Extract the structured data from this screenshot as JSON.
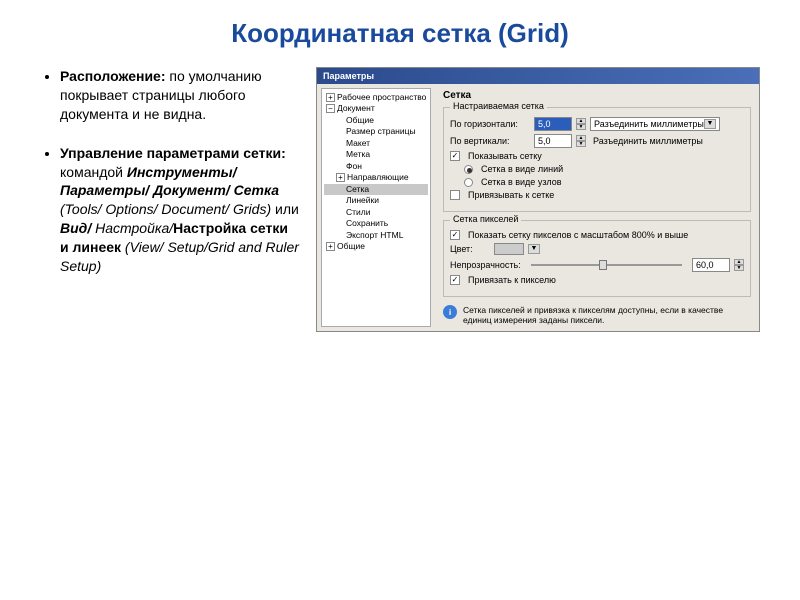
{
  "title": "Координатная сетка (Grid)",
  "bullets": {
    "b1_label": "Расположение:",
    "b1_text": " по умолчанию покрывает страницы любого документа и не видна.",
    "b2_label": "Управление параметрами сетки:",
    "b2_text1": " командой ",
    "b2_bi1": "Инструменты/ Параметры/ Документ/ Сетка",
    "b2_it1": " (Tools/ Options/ Document/ Grids)",
    "b2_text2": " или ",
    "b2_bi2": "Вид/",
    "b2_it2": " Настройка/",
    "b2_b3": "Настройка сетки и линеек",
    "b2_it3": " (View/ Setup/Grid and Ruler Setup)"
  },
  "dialog": {
    "title": "Параметры",
    "tree": {
      "workspace": "Рабочее пространство",
      "document": "Документ",
      "general": "Общие",
      "pagesize": "Размер страницы",
      "layout": "Макет",
      "label": "Метка",
      "background": "Фон",
      "guides": "Направляющие",
      "grid": "Сетка",
      "rulers": "Линейки",
      "styles": "Стили",
      "save": "Сохранить",
      "export": "Экспорт HTML",
      "global": "Общие"
    },
    "panel": {
      "heading": "Сетка",
      "group1": "Настраиваемая сетка",
      "horiz_label": "По горизонтали:",
      "horiz_val": "5,0",
      "vert_label": "По вертикали:",
      "vert_val": "5,0",
      "unit_text": "Разъединить миллиметры",
      "show_grid": "Показывать сетку",
      "grid_lines": "Сетка в виде линий",
      "grid_nodes": "Сетка в виде узлов",
      "snap_grid": "Привязывать к сетке",
      "group2": "Сетка пикселей",
      "show_pixel": "Показать сетку пикселов с масштабом 800% и выше",
      "color_label": "Цвет:",
      "opacity_label": "Непрозрачность:",
      "opacity_val": "60,0",
      "snap_pixel": "Привязать к пикселю",
      "info_text": "Сетка пикселей и привязка к пикселям доступны, если в качестве единиц измерения заданы пиксели."
    }
  }
}
